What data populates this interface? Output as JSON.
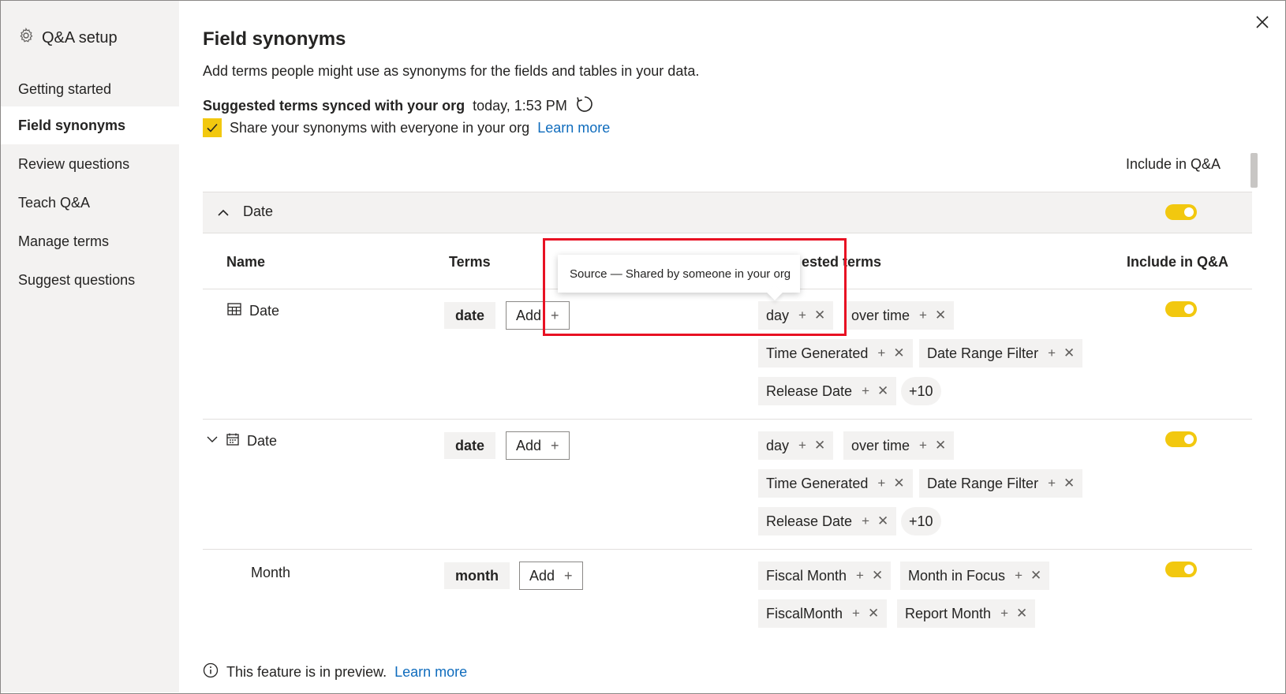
{
  "sidebar": {
    "title": "Q&A setup",
    "items": [
      {
        "label": "Getting started"
      },
      {
        "label": "Field synonyms"
      },
      {
        "label": "Review questions"
      },
      {
        "label": "Teach Q&A"
      },
      {
        "label": "Manage terms"
      },
      {
        "label": "Suggest questions"
      }
    ]
  },
  "main": {
    "title": "Field synonyms",
    "description": "Add terms people might use as synonyms for the fields and tables in your data.",
    "sync_label": "Suggested terms synced with your org",
    "sync_time": "today, 1:53 PM",
    "share_label": "Share your synonyms with everyone in your org",
    "learn_more": "Learn more",
    "include_header": "Include in Q&A",
    "table_name": "Date",
    "columns": {
      "name": "Name",
      "terms": "Terms",
      "suggested_visible_fragment": "ested terms",
      "include": "Include in Q&A"
    },
    "tooltip": "Source — Shared by someone in your org",
    "add_label": "Add",
    "more_label": "+10",
    "rows": [
      {
        "name": "Date",
        "term": "date",
        "suggested": [
          "day",
          "over time",
          "Time Generated",
          "Date Range Filter",
          "Release Date"
        ]
      },
      {
        "name": "Date",
        "term": "date",
        "suggested": [
          "day",
          "over time",
          "Time Generated",
          "Date Range Filter",
          "Release Date"
        ]
      },
      {
        "name": "Month",
        "term": "month",
        "suggested": [
          "Fiscal Month",
          "Month in Focus",
          "FiscalMonth",
          "Report Month"
        ]
      }
    ],
    "footer_text": "This feature is in preview.",
    "footer_link": "Learn more"
  },
  "colors": {
    "accent": "#f2c80f",
    "link": "#0f6cbd",
    "highlight": "#e81123",
    "sidebar_bg": "#f3f2f1"
  }
}
